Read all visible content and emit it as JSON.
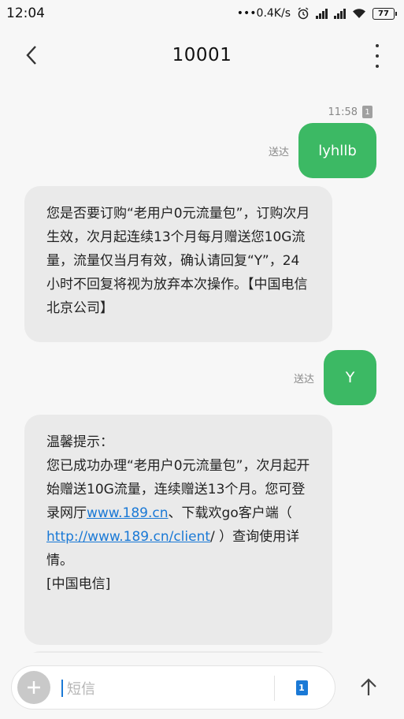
{
  "status_bar": {
    "time": "12:04",
    "speed": "0.4K/s",
    "battery": "77"
  },
  "header": {
    "title": "10001"
  },
  "thread": {
    "timestamp": "11:58",
    "sim_slot": "1",
    "messages": [
      {
        "direction": "out",
        "text": "lyhllb",
        "status": "送达"
      },
      {
        "direction": "in",
        "text": "您是否要订购“老用户0元流量包”，订购次月生效，次月起连续13个月每月赠送您10G流量，流量仅当月有效，确认请回复“Y”，24小时不回复将视为放弃本次操作。【中国电信北京公司】"
      },
      {
        "direction": "out",
        "text": "Y",
        "status": "送达"
      },
      {
        "direction": "in",
        "line1": "温馨提示：",
        "part_a": "您已成功办理“老用户0元流量包”，次月起开始赠送10G流量，连续赠送13个月。您可登录网厅",
        "link1": "www.189.cn",
        "part_b": "、下载欢go客户端（ ",
        "link2": "http://www.189.cn/client",
        "part_c": "/ ）查询使用详情。",
        "line_sig": "[中国电信]"
      }
    ]
  },
  "input_bar": {
    "placeholder": "短信",
    "sim_slot": "1"
  },
  "colors": {
    "outgoing_bubble": "#3cb964",
    "incoming_bubble": "#eaeaea",
    "link": "#1a79d6"
  }
}
